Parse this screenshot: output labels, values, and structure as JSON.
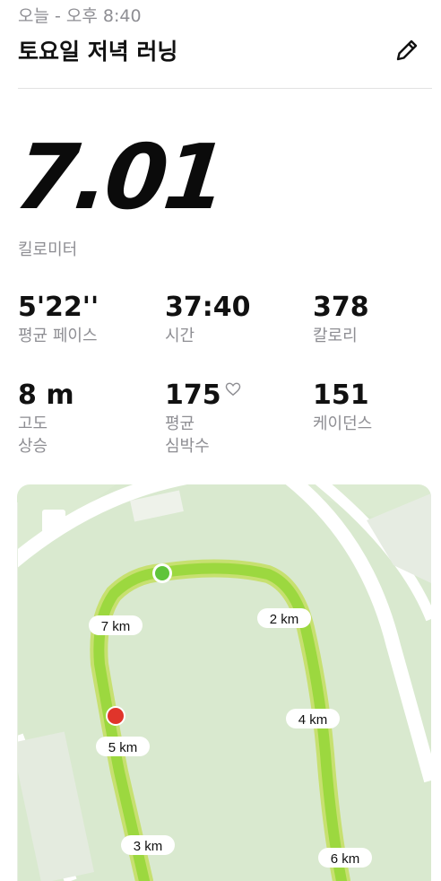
{
  "header": {
    "timestamp": "오늘 - 오후 8:40",
    "title": "토요일 저녁 러닝",
    "edit_icon": "pencil-icon"
  },
  "summary": {
    "distance": "7.01",
    "distance_unit": "킬로미터"
  },
  "stats": [
    {
      "value": "5'22''",
      "label": "평균 페이스"
    },
    {
      "value": "37:40",
      "label": "시간"
    },
    {
      "value": "378",
      "label": "칼로리"
    },
    {
      "value": "8 m",
      "label_line1": "고도",
      "label_line2": "상승"
    },
    {
      "value": "175",
      "label_line1": "평균",
      "label_line2": "심박수",
      "icon": "heart-icon"
    },
    {
      "value": "151",
      "label": "케이던스"
    }
  ],
  "map": {
    "km_markers": [
      "7 km",
      "2 km",
      "4 km",
      "5 km",
      "3 km",
      "6 km"
    ],
    "start_color": "#5fc43a",
    "end_color": "#e0352b",
    "route_color": "#9cd83f",
    "grass_color": "#dcebd2"
  }
}
